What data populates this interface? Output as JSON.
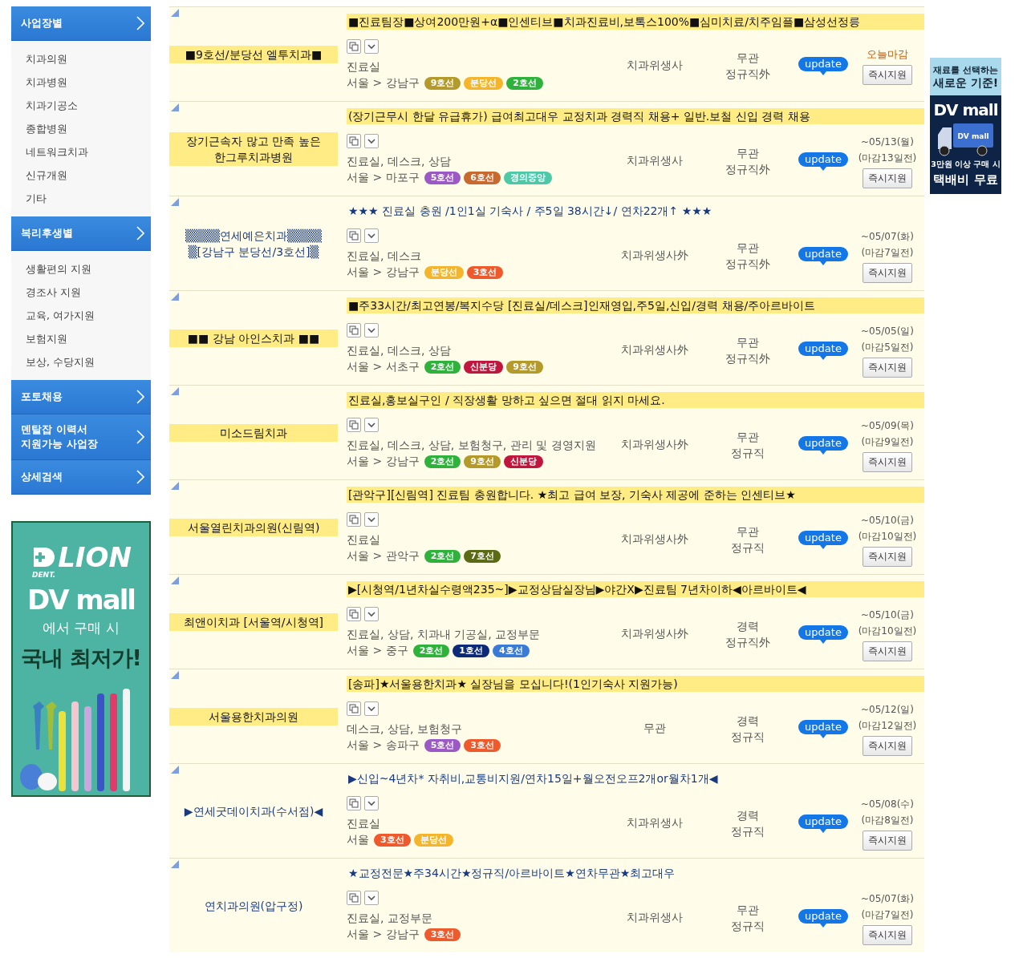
{
  "sidebar": {
    "sections": [
      {
        "lines": [
          "사업장별"
        ],
        "items": [
          "치과의원",
          "치과병원",
          "치과기공소",
          "종합병원",
          "네트워크치과",
          "신규개원",
          "기타"
        ]
      },
      {
        "lines": [
          "복리후생별"
        ],
        "items": [
          "생활편의 지원",
          "경조사 지원",
          "교육, 여가지원",
          "보험지원",
          "보상, 수당지원"
        ]
      },
      {
        "lines": [
          "포토채용"
        ]
      },
      {
        "lines": [
          "덴탈잡 이력서",
          "지원가능 사업장"
        ]
      },
      {
        "lines": [
          "상세검색"
        ]
      }
    ]
  },
  "left_ad": {
    "brand": "LION",
    "brand_sub": "DENT.",
    "mall": "DV mall",
    "line1": "에서 구매 시",
    "line2": "국내 최저가!"
  },
  "right_ad": {
    "line1": "재료를 선택하는",
    "line2": "새로운 기준!",
    "mall": "DV mall",
    "truck_label": "DV mall",
    "line3": "3만원 이상 구매 시",
    "line4": "택배비 무료"
  },
  "rows": [
    {
      "company": "■9호선/분당선 엘투치과■",
      "highlighted": true,
      "title": "■진료팀장■상여200만원+α■인센티브■치과진료비,보톡스100%■심미치료/치주임플■삼성선정릉",
      "tasks": "진료실",
      "location": "서울 > 강남구",
      "lines": [
        {
          "name": "9호선",
          "color": "#b39a2a"
        },
        {
          "name": "분당선",
          "color": "#f5b52a"
        },
        {
          "name": "2호선",
          "color": "#2fb23b"
        }
      ],
      "profession": "치과위생사",
      "employment": [
        "무관",
        "정규직外"
      ],
      "badge": "update",
      "deadline": {
        "kind": "today",
        "text": "오늘마감"
      },
      "apply": "즉시지원"
    },
    {
      "company": "장기근속자 많고 만족 높은 한그루치과병원",
      "highlighted": true,
      "title": "(장기근무시 한달 유급휴가) 급여최고대우 교정치과 경력직 채용+ 일반.보철 신입 경력 채용",
      "tasks": "진료실, 데스크, 상담",
      "location": "서울 > 마포구",
      "lines": [
        {
          "name": "5호선",
          "color": "#9b59c6"
        },
        {
          "name": "6호선",
          "color": "#c8692f"
        },
        {
          "name": "경의중앙",
          "color": "#4ec9a8"
        }
      ],
      "profession": "치과위생사",
      "employment": [
        "무관",
        "정규직外"
      ],
      "badge": "update",
      "deadline": {
        "kind": "date",
        "date": "~05/13(월)",
        "remain": "(마감13일전)"
      },
      "apply": "즉시지원"
    },
    {
      "company": "▒▒▒▒연세예은치과▒▒▒▒ ▒[강남구 분당선/3호선]▒",
      "highlighted": false,
      "title": "★★★ 진료실 충원 /1인1실 기숙사 / 주5일 38시간↓/ 연차22개↑ ★★★",
      "tasks": "진료실, 데스크",
      "location": "서울 > 강남구",
      "lines": [
        {
          "name": "분당선",
          "color": "#f5b52a"
        },
        {
          "name": "3호선",
          "color": "#ef5a2c"
        }
      ],
      "profession": "치과위생사外",
      "employment": [
        "무관",
        "정규직外"
      ],
      "badge": "update",
      "deadline": {
        "kind": "date",
        "date": "~05/07(화)",
        "remain": "(마감7일전)"
      },
      "apply": "즉시지원"
    },
    {
      "company": "■■ 강남 아인스치과 ■■",
      "highlighted": true,
      "title": "■주33시간/최고연봉/복지수당 [진료실/데스크]인재영입,주5일,신입/경력 채용/주아르바이트",
      "tasks": "진료실, 데스크, 상담",
      "location": "서울 > 서초구",
      "lines": [
        {
          "name": "2호선",
          "color": "#2fb23b"
        },
        {
          "name": "신분당",
          "color": "#c0163d"
        },
        {
          "name": "9호선",
          "color": "#b39a2a"
        }
      ],
      "profession": "치과위생사外",
      "employment": [
        "무관",
        "정규직外"
      ],
      "badge": "update",
      "deadline": {
        "kind": "date",
        "date": "~05/05(일)",
        "remain": "(마감5일전)"
      },
      "apply": "즉시지원"
    },
    {
      "company": "미소드림치과",
      "highlighted": true,
      "title": "진료실,홍보실구인 / 직장생활 망하고 싶으면 절대 읽지 마세요.",
      "tasks": "진료실, 데스크, 상담, 보험청구, 관리 및 경영지원",
      "location": "서울 > 강남구",
      "lines": [
        {
          "name": "2호선",
          "color": "#2fb23b"
        },
        {
          "name": "9호선",
          "color": "#b39a2a"
        },
        {
          "name": "신분당",
          "color": "#c0163d"
        }
      ],
      "profession": "치과위생사外",
      "employment": [
        "무관",
        "정규직"
      ],
      "badge": "update",
      "deadline": {
        "kind": "date",
        "date": "~05/09(목)",
        "remain": "(마감9일전)"
      },
      "apply": "즉시지원"
    },
    {
      "company": "서울열린치과의원(신림역)",
      "highlighted": true,
      "title": "[관악구][신림역] 진료팀 충원합니다. ★최고 급여 보장, 기숙사 제공에 준하는 인센티브★",
      "tasks": "진료실",
      "location": "서울 > 관악구",
      "lines": [
        {
          "name": "2호선",
          "color": "#2fb23b"
        },
        {
          "name": "7호선",
          "color": "#5b6a14"
        }
      ],
      "profession": "치과위생사外",
      "employment": [
        "무관",
        "정규직"
      ],
      "badge": "update",
      "deadline": {
        "kind": "date",
        "date": "~05/10(금)",
        "remain": "(마감10일전)"
      },
      "apply": "즉시지원"
    },
    {
      "company": "최앤이치과 [서울역/시청역]",
      "highlighted": true,
      "title": "▶[시청역/1년차실수령액235~]▶교정상담실장님▶야간X▶진료팀 7년차이하◀아르바이트◀",
      "tasks": "진료실, 상담, 치과내 기공실, 교정부문",
      "location": "서울 > 중구",
      "lines": [
        {
          "name": "2호선",
          "color": "#2fb23b"
        },
        {
          "name": "1호선",
          "color": "#0d2a78"
        },
        {
          "name": "4호선",
          "color": "#3a7bd8"
        }
      ],
      "profession": "치과위생사外",
      "employment": [
        "경력",
        "정규직外"
      ],
      "badge": "update",
      "deadline": {
        "kind": "date",
        "date": "~05/10(금)",
        "remain": "(마감10일전)"
      },
      "apply": "즉시지원"
    },
    {
      "company": "서울용한치과의원",
      "highlighted": true,
      "title": "[송파]★서울용한치과★ 실장님을 모십니다!(1인기숙사 지원가능)",
      "tasks": "데스크, 상담, 보험청구",
      "location": "서울 > 송파구",
      "lines": [
        {
          "name": "5호선",
          "color": "#9b59c6"
        },
        {
          "name": "3호선",
          "color": "#ef5a2c"
        }
      ],
      "profession": "무관",
      "employment": [
        "경력",
        "정규직"
      ],
      "badge": "update",
      "deadline": {
        "kind": "date",
        "date": "~05/12(일)",
        "remain": "(마감12일전)"
      },
      "apply": "즉시지원"
    },
    {
      "company": "▶연세굿데이치과(수서점)◀",
      "highlighted": false,
      "title": "▶신입~4년차* 자취비,교통비지원/연차15일+월오전오프2개or월차1개◀",
      "tasks": "진료실",
      "location": "서울",
      "lines": [
        {
          "name": "3호선",
          "color": "#ef5a2c"
        },
        {
          "name": "분당선",
          "color": "#f5b52a"
        }
      ],
      "profession": "치과위생사",
      "employment": [
        "경력",
        "정규직"
      ],
      "badge": "update",
      "deadline": {
        "kind": "date",
        "date": "~05/08(수)",
        "remain": "(마감8일전)"
      },
      "apply": "즉시지원"
    },
    {
      "company": "연치과의원(압구정)",
      "highlighted": false,
      "title": "★교정전문★주34시간★정규직/아르바이트★연차무관★최고대우",
      "tasks": "진료실, 교정부문",
      "location": "서울 > 강남구",
      "lines": [
        {
          "name": "3호선",
          "color": "#ef5a2c"
        }
      ],
      "profession": "치과위생사",
      "employment": [
        "무관",
        "정규직"
      ],
      "badge": "update",
      "deadline": {
        "kind": "date",
        "date": "~05/07(화)",
        "remain": "(마감7일전)"
      },
      "apply": "즉시지원"
    }
  ]
}
